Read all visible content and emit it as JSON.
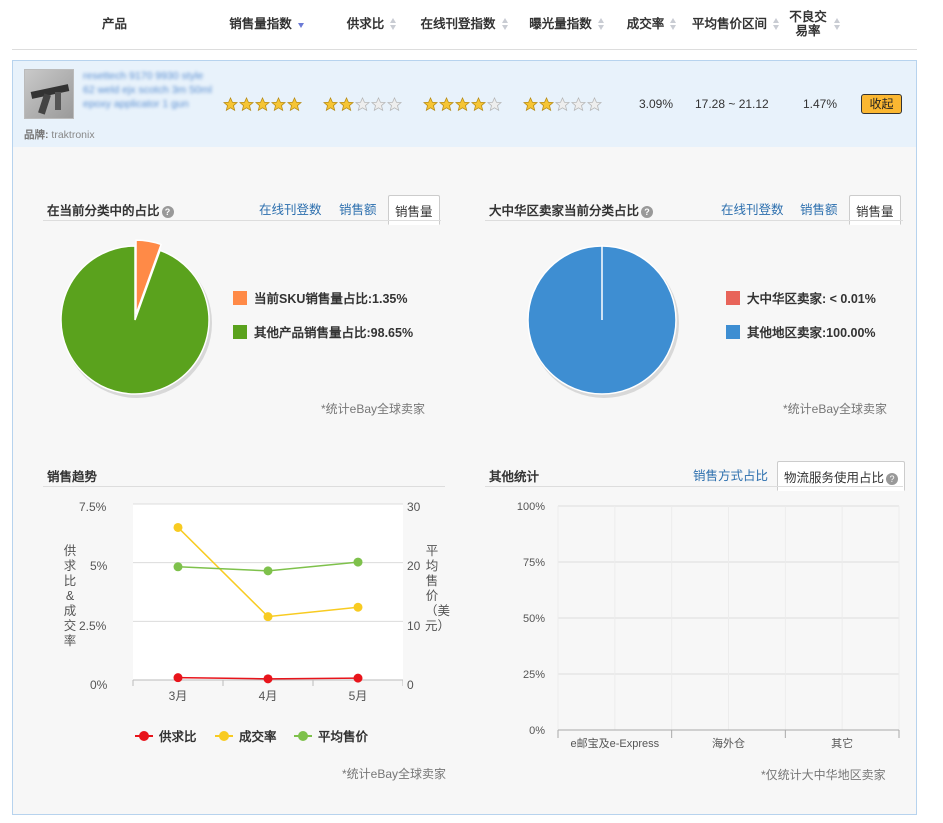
{
  "table_header": {
    "columns": [
      "产品",
      "销售量指数",
      "供求比",
      "在线刊登指数",
      "曝光量指数",
      "成交率",
      "平均售价区间",
      "不良交易率"
    ]
  },
  "product": {
    "title": "resettech 9170 9930 style 62 weld ejx scotch 3m 50ml epoxy applicator 1 gun",
    "brand_label": "品牌:",
    "brand": "traktronix",
    "sales_index_stars": 5,
    "supply_ratio_stars": 2,
    "listing_index_stars": 4,
    "exposure_index_stars": 2,
    "conversion_rate": "3.09%",
    "avg_price_range": "17.28 ~ 21.12",
    "bad_trade_rate": "1.47%",
    "collapse_label": "收起"
  },
  "category_share": {
    "title": "在当前分类中的占比",
    "help": "?",
    "tabs": [
      "在线刊登数",
      "销售额",
      "销售量"
    ],
    "active_tab": "销售量",
    "legend": [
      "当前SKU销售量占比:1.35%",
      "其他产品销售量占比:98.65%"
    ],
    "note": "*统计eBay全球卖家"
  },
  "china_share": {
    "title": "大中华区卖家当前分类占比",
    "help": "?",
    "tabs": [
      "在线刊登数",
      "销售额",
      "销售量"
    ],
    "active_tab": "销售量",
    "legend": [
      "大中华区卖家: < 0.01%",
      "其他地区卖家:100.00%"
    ],
    "note": "*统计eBay全球卖家"
  },
  "sales_trend": {
    "title": "销售趋势",
    "left_axis_label": "供求比&成交率",
    "right_axis_label": "平均售价（美元）",
    "left_ticks": [
      "7.5%",
      "5%",
      "2.5%",
      "0%"
    ],
    "right_ticks": [
      "30",
      "20",
      "10",
      "0"
    ],
    "legend": [
      "供求比",
      "成交率",
      "平均售价"
    ],
    "note": "*统计eBay全球卖家"
  },
  "other_stats": {
    "title": "其他统计",
    "tabs": [
      "销售方式占比",
      "物流服务使用占比"
    ],
    "active_tab": "物流服务使用占比",
    "help": "?",
    "y_ticks": [
      "100%",
      "75%",
      "50%",
      "25%",
      "0%"
    ],
    "categories": [
      "e邮宝及e-Express",
      "海外仓",
      "其它"
    ],
    "note": "*仅统计大中华地区卖家"
  },
  "chart_data": [
    {
      "type": "pie",
      "title": "在当前分类中的占比",
      "labels": [
        "当前SKU销售量占比",
        "其他产品销售量占比"
      ],
      "values": [
        1.35,
        98.65
      ],
      "colors": [
        "#ff8a47",
        "#5aa21d"
      ]
    },
    {
      "type": "pie",
      "title": "大中华区卖家当前分类占比",
      "labels": [
        "大中华区卖家",
        "其他地区卖家"
      ],
      "values": [
        0.01,
        100.0
      ],
      "colors": [
        "#e8645a",
        "#3e8ed2"
      ]
    },
    {
      "type": "line",
      "title": "销售趋势",
      "x": [
        "3月",
        "4月",
        "5月"
      ],
      "series": [
        {
          "name": "供求比",
          "axis": "left",
          "unit": "%",
          "values": [
            0.1,
            0.05,
            0.08
          ],
          "color": "#e8141b"
        },
        {
          "name": "成交率",
          "axis": "left",
          "unit": "%",
          "values": [
            6.5,
            2.7,
            3.1
          ],
          "color": "#f8cb21"
        },
        {
          "name": "平均售价",
          "axis": "right",
          "unit": "美元",
          "values": [
            19.3,
            18.6,
            20.1
          ],
          "color": "#7ec14b"
        }
      ],
      "ylim_left": [
        0,
        7.5
      ],
      "ylim_right": [
        0,
        30
      ]
    },
    {
      "type": "bar",
      "title": "物流服务使用占比",
      "categories": [
        "e邮宝及e-Express",
        "海外仓",
        "其它"
      ],
      "values": [
        0,
        0,
        0
      ],
      "ylim": [
        0,
        100
      ]
    }
  ]
}
